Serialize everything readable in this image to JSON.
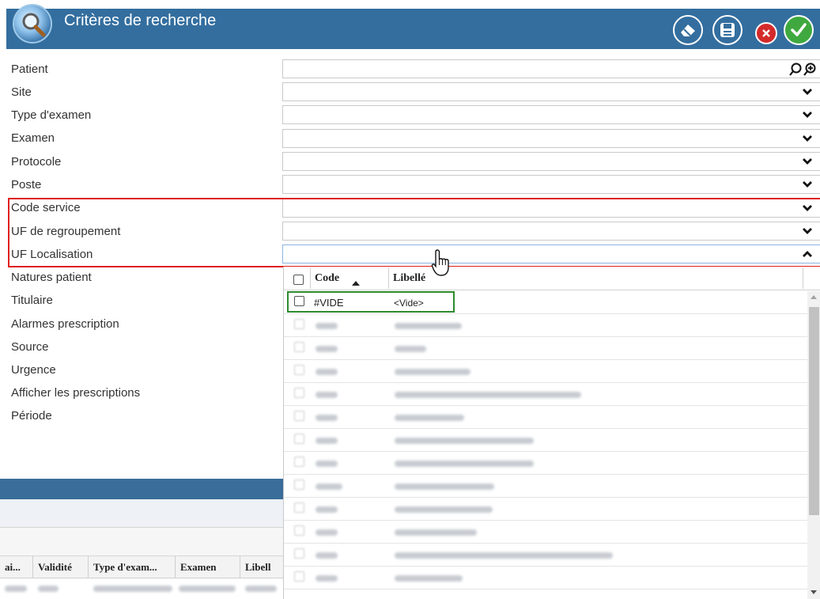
{
  "header": {
    "title": "Critères de recherche",
    "icons": [
      "search-icon",
      "eraser-icon",
      "save-icon",
      "close-icon",
      "check-icon"
    ],
    "colors": {
      "bar": "#336e9f",
      "cancel": "#d42a2a",
      "ok": "#3fa93f"
    }
  },
  "criteria": [
    "Patient",
    "Site",
    "Type d'examen",
    "Examen",
    "Protocole",
    "Poste",
    "Code service",
    "UF de regroupement",
    "UF Localisation",
    "Natures patient",
    "Titulaire",
    "Alarmes prescription",
    "Source",
    "Urgence",
    "Afficher les prescriptions",
    "Période"
  ],
  "dropdown": {
    "columns": {
      "code": "Code",
      "libelle": "Libellé"
    },
    "first_row": {
      "code": "#VIDE",
      "libelle": "<Vide>"
    }
  },
  "background_grid": {
    "columns": [
      "ai...",
      "Validité",
      "Type d'exam...",
      "Examen",
      "Libell"
    ]
  }
}
